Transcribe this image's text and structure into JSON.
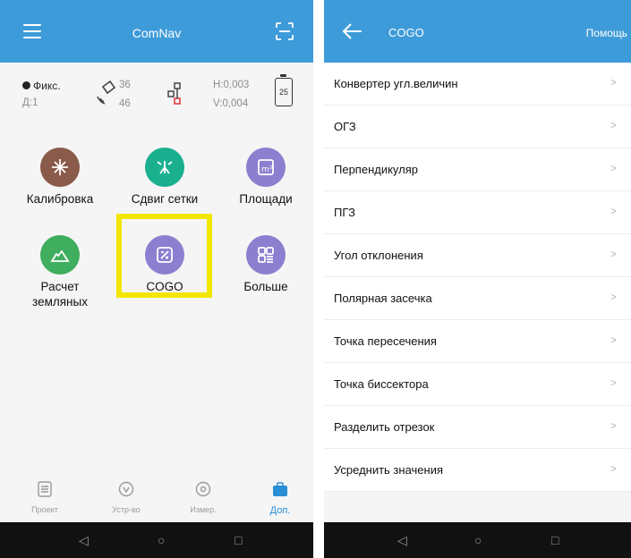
{
  "left": {
    "header": {
      "title": "ComNav",
      "menu_icon": "hamburger-menu-icon",
      "scan_icon": "scan-icon"
    },
    "status": {
      "fix_label": "Фикс.",
      "age_label": "Д:1",
      "satellites_top": "36",
      "satellites_bottom": "46",
      "h_precision": "H:0,003",
      "v_precision": "V:0,004",
      "battery": "25"
    },
    "grid": [
      {
        "label": "Калибровка",
        "color": "#8a5a4a",
        "icon": "calibration-icon"
      },
      {
        "label": "Сдвиг сетки",
        "color": "#1aaf8f",
        "icon": "grid-shift-icon"
      },
      {
        "label": "Площади",
        "color": "#8c7fd0",
        "icon": "area-icon"
      },
      {
        "label": "Расчет\nземляных",
        "color": "#3fae5e",
        "icon": "earthwork-icon"
      },
      {
        "label": "COGO",
        "color": "#8c7fd0",
        "icon": "cogo-icon"
      },
      {
        "label": "Больше",
        "color": "#8c7fd0",
        "icon": "more-icon"
      }
    ],
    "bottom_nav": [
      {
        "label": "Проект",
        "icon": "project-icon"
      },
      {
        "label": "Устр-во",
        "icon": "device-icon"
      },
      {
        "label": "Измер.",
        "icon": "survey-icon"
      },
      {
        "label": "Доп.",
        "icon": "tools-icon",
        "active": true
      }
    ],
    "accent": "#3e9bd9",
    "highlight_color": "#f2e600"
  },
  "right": {
    "header": {
      "title": "COGO",
      "help": "Помощь",
      "back_icon": "back-arrow-icon"
    },
    "items": [
      "Конвертер угл.величин",
      "ОГЗ",
      "Перпендикуляр",
      "ПГЗ",
      "Угол отклонения",
      "Полярная засечка",
      "Точка пересечения",
      "Точка биссектора",
      "Разделить отрезок",
      "Усреднить значения"
    ]
  },
  "system_bar": {
    "back": "◁",
    "home": "○",
    "recent": "□"
  }
}
